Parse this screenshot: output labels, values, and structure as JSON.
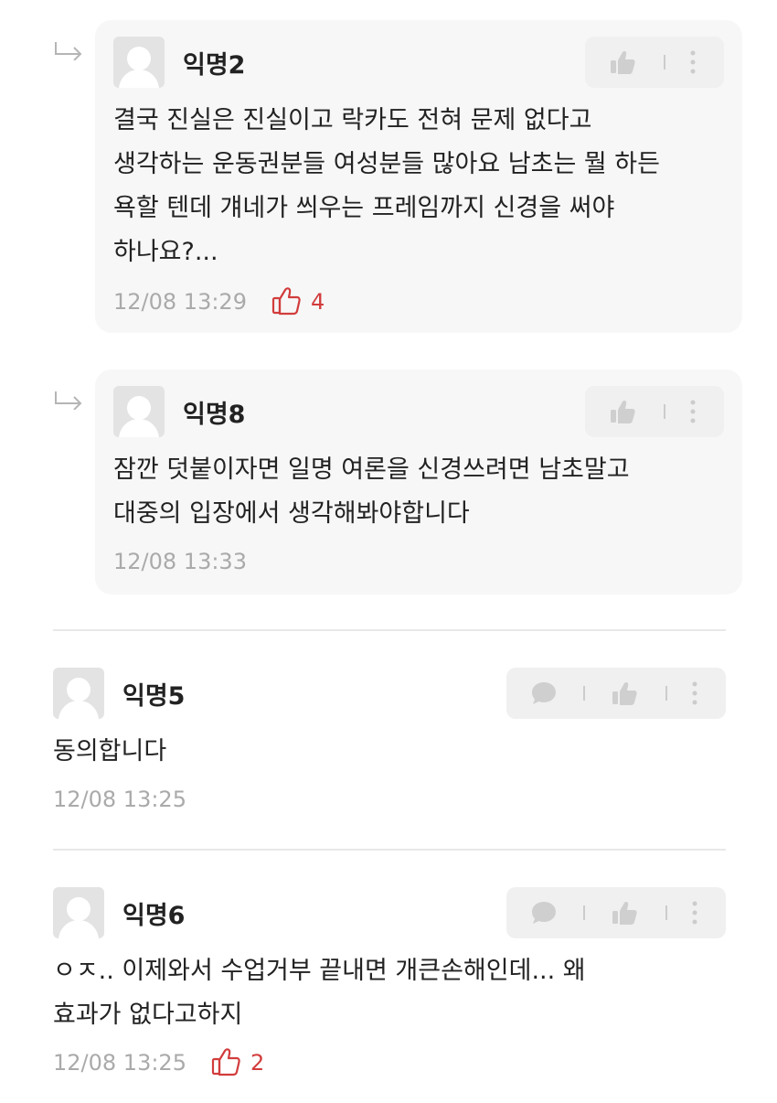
{
  "comments": [
    {
      "nickname": "익명2",
      "content": "결국 진실은 진실이고 락카도 전혀 문제 없다고\n생각하는 운동권분들 여성분들 많아요 남초는 뭘 하든\n욕할 텐데 걔네가 씌우는 프레임까지 신경을 써야\n하나요?...",
      "timestamp": "12/08 13:29",
      "likes": "4"
    },
    {
      "nickname": "익명8",
      "content": "잠깐 덧붙이자면 일명 여론을 신경쓰려면 남초말고\n대중의 입장에서 생각해봐야합니다",
      "timestamp": "12/08 13:33",
      "likes": ""
    },
    {
      "nickname": "익명5",
      "content": "동의합니다",
      "timestamp": "12/08 13:25",
      "likes": ""
    },
    {
      "nickname": "익명6",
      "content": "ㅇㅈ.. 이제와서 수업거부 끝내면 개큰손해인데... 왜\n효과가 없다고하지",
      "timestamp": "12/08 13:25",
      "likes": "2"
    }
  ],
  "colors": {
    "like_accent": "#d23c3c",
    "meta_gray": "#aaaaaa",
    "reply_bg": "#f7f7f7",
    "pill_bg": "#f0f0f0"
  },
  "icons": [
    "reply-arrow-icon",
    "avatar-default-icon",
    "thumbs-up-icon",
    "more-vertical-icon",
    "comment-bubble-icon"
  ]
}
